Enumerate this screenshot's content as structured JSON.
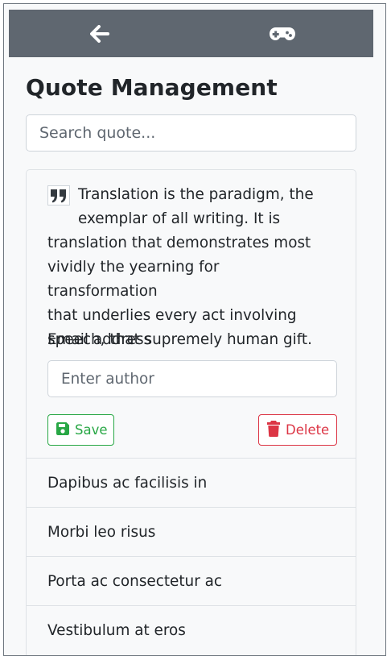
{
  "navbar": {
    "back_icon": "arrow-left-icon",
    "game_icon": "gamepad-icon",
    "background": "#5f6770"
  },
  "page": {
    "title": "Quote Management"
  },
  "search": {
    "placeholder": "Search quote..."
  },
  "editor": {
    "quote_icon": "quote-right-icon",
    "quote_text_lines": [
      "Translation is the paradigm, the",
      "exemplar of all writing. It is",
      "translation that demonstrates most",
      "vividly the yearning for transformation",
      "that underlies every act involving",
      "speech, that supremely human gift."
    ],
    "field_label": "Email address",
    "author_placeholder": "Enter author",
    "save_label": "Save",
    "save_icon": "floppy-disk-icon",
    "delete_label": "Delete",
    "delete_icon": "trash-icon",
    "save_color": "#28a745",
    "delete_color": "#dc3545"
  },
  "quotes": [
    {
      "label": "Dapibus ac facilisis in"
    },
    {
      "label": "Morbi leo risus"
    },
    {
      "label": "Porta ac consectetur ac"
    },
    {
      "label": "Vestibulum at eros"
    }
  ]
}
